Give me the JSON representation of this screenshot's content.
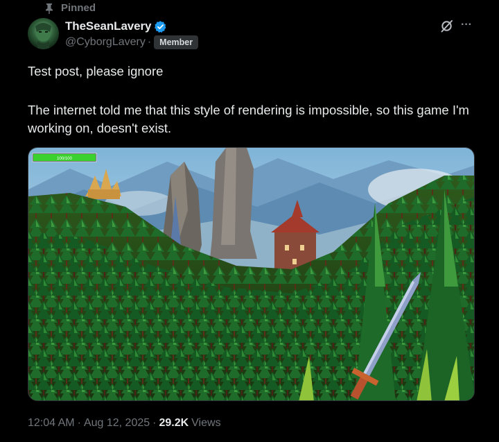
{
  "pinned_label": "Pinned",
  "author": {
    "display_name": "TheSeanLavery",
    "handle": "@CyborgLavery",
    "badge": "Member",
    "verified_color": "#1d9bf0"
  },
  "post": {
    "line_1": "Test post, please ignore",
    "line_2": "The internet told me that this style of rendering is impossible, so this game I'm working on, doesn't exist.",
    "health_bar_text": "100/100"
  },
  "meta": {
    "time": "12:04 AM",
    "date": "Aug 12, 2025",
    "views_count": "29.2K",
    "views_label": "Views"
  },
  "icons": {
    "pin": "pin-icon",
    "verified": "verified-badge-icon",
    "grok": "grok-icon",
    "more": "more-icon"
  }
}
